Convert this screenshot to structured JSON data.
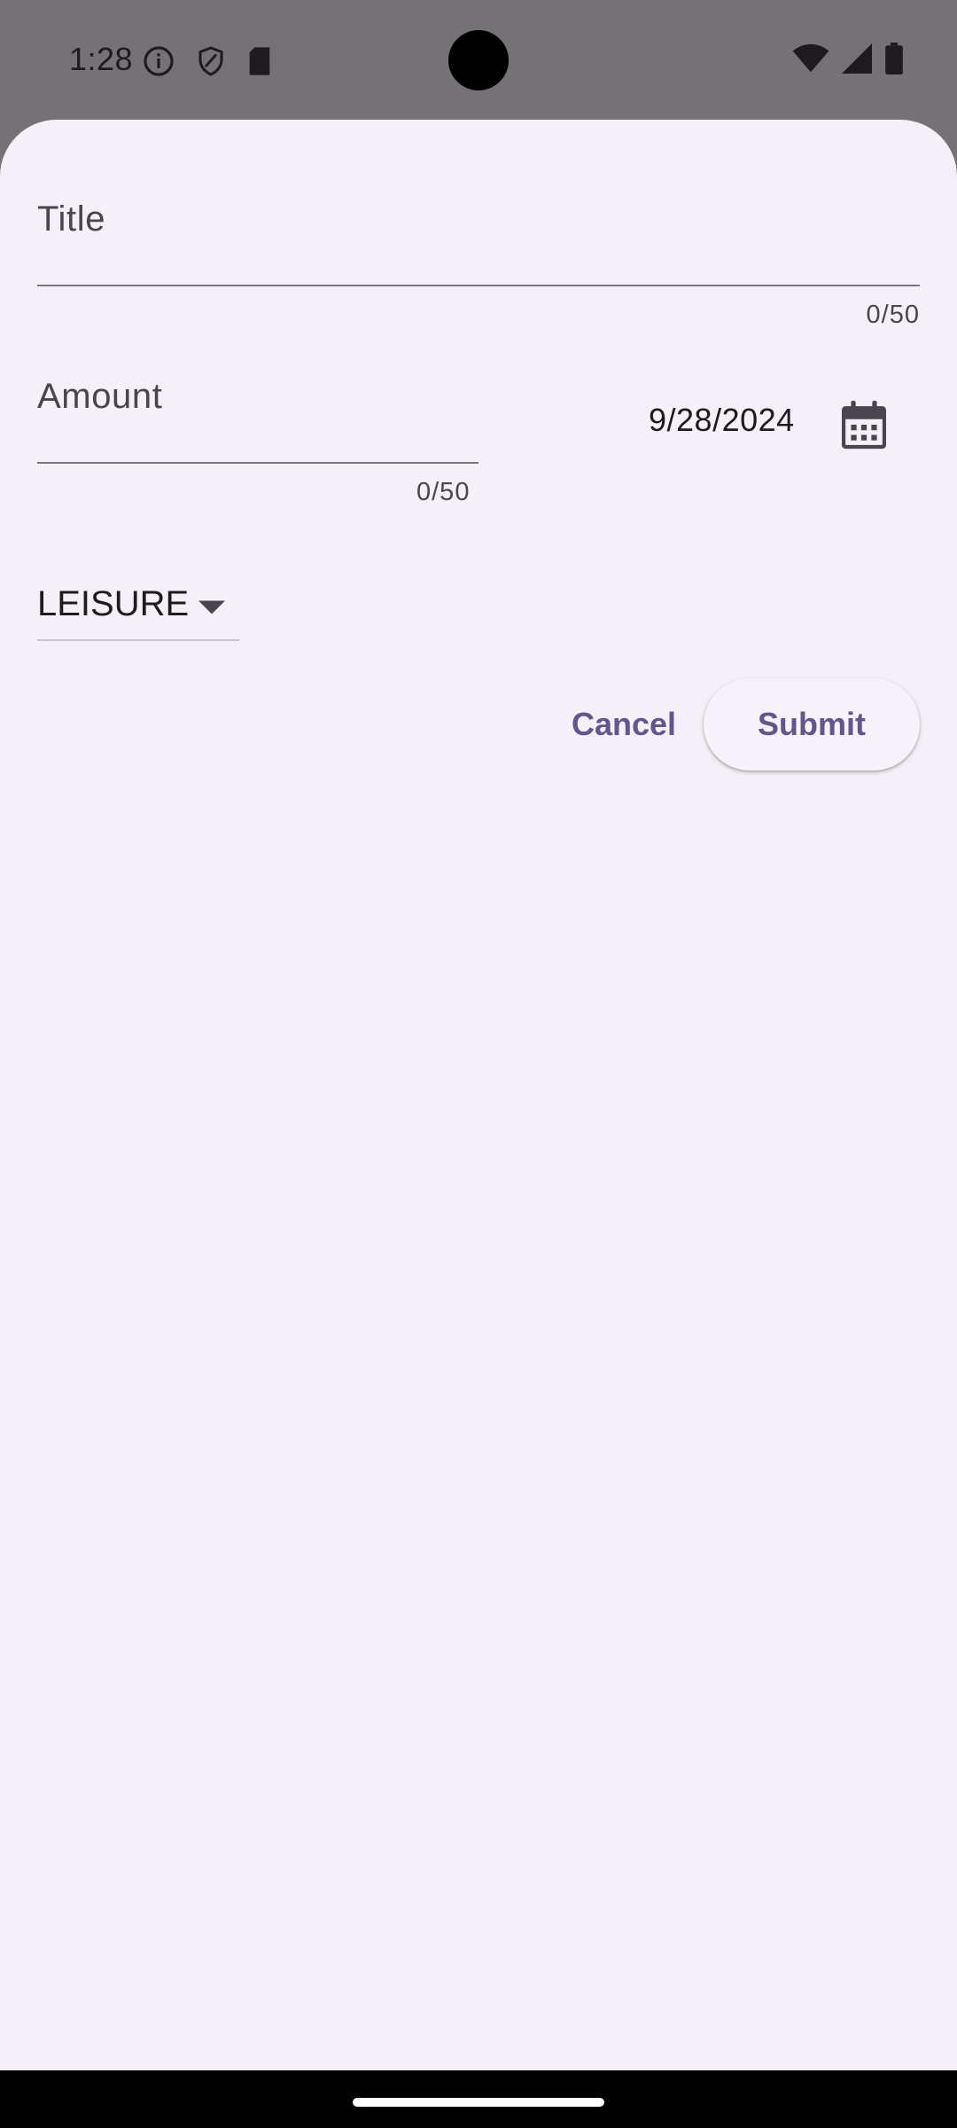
{
  "status_bar": {
    "time": "1:28",
    "left_icons": [
      "info-icon",
      "shield-icon",
      "sd-card-icon"
    ],
    "right_icons": [
      "wifi-icon",
      "signal-icon",
      "battery-icon"
    ]
  },
  "form": {
    "title": {
      "label": "Title",
      "counter": "0/50",
      "value": ""
    },
    "amount": {
      "label": "Amount",
      "counter": "0/50",
      "value": ""
    },
    "date": {
      "value": "9/28/2024"
    },
    "category": {
      "selected": "LEISURE"
    },
    "actions": {
      "cancel_label": "Cancel",
      "submit_label": "Submit"
    }
  },
  "colors": {
    "sheet_background": "#f5f0f7",
    "accent": "#65558f",
    "scrim": "#757275"
  }
}
